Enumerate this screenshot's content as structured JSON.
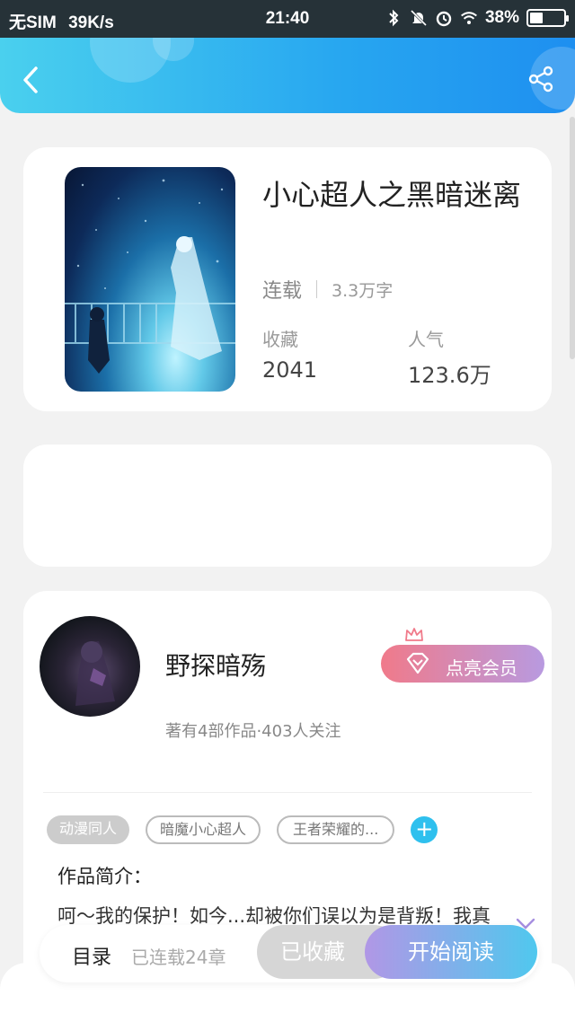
{
  "status_bar": {
    "carrier": "无SIM",
    "speed": "39K/s",
    "time": "21:40",
    "battery": "38%",
    "battery_level": 0.38,
    "icons": [
      "bluetooth-icon",
      "mute-icon",
      "alarm-icon",
      "wifi-icon",
      "battery-icon"
    ]
  },
  "header": {
    "back_icon": "chevron-left-icon",
    "share_icon": "share-icon",
    "colors": {
      "start": "#4ad0ee",
      "end": "#1e8ff0"
    }
  },
  "book": {
    "title": "小心超人之黑暗迷离",
    "status": "连载",
    "word_count": "3.3万字",
    "stats": [
      {
        "label": "收藏",
        "value": "2041"
      },
      {
        "label": "人气",
        "value": "123.6万"
      }
    ]
  },
  "author": {
    "name": "野探暗殇",
    "member_button": "点亮会员",
    "meta": "著有4部作品·403人关注"
  },
  "tags": [
    "动漫同人",
    "暗魔小心超人",
    "王者荣耀的..."
  ],
  "intro": {
    "title": "作品简介：",
    "text": "呵～我的保护！如今...却被你们误以为是背叛！我真"
  },
  "bottom_bar": {
    "toc_label": "目录",
    "toc_sub": "已连载24章",
    "collected_button": "已收藏",
    "read_button": "开始阅读"
  }
}
